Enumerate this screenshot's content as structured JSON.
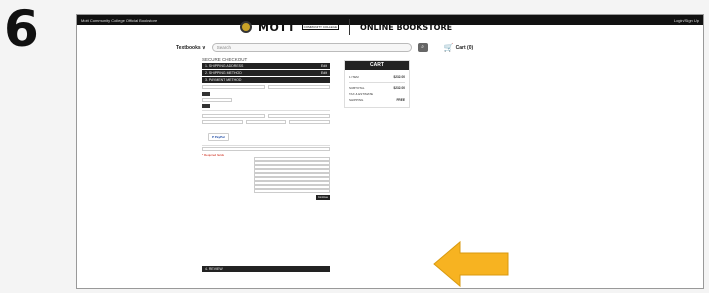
{
  "step_number": "6",
  "topbar": {
    "left": "Mott Community College Official Bookstore",
    "right": "Login/Sign Up"
  },
  "brand": {
    "name": "MOTT",
    "sub": "COMMUNITY COLLEGE",
    "store": "ONLINE BOOKSTORE"
  },
  "nav": {
    "textbooks": "Textbooks ∨",
    "search_placeholder": "Search",
    "cart": "Cart (0)"
  },
  "checkout": {
    "title": "SECURE CHECKOUT",
    "steps": [
      {
        "label": "1. SHIPPING ADDRESS",
        "action": "Edit"
      },
      {
        "label": "2. SHIPPING METHOD",
        "action": "Edit"
      },
      {
        "label": "3. PAYMENT METHOD",
        "action": ""
      }
    ],
    "review": "4. REVIEW",
    "continue": "Continue",
    "required_label": "* Required fields"
  },
  "cart": {
    "title": "CART",
    "lines": [
      {
        "label": "1 ITEM",
        "value": "$232.00"
      },
      {
        "label": "SUBTOTAL",
        "value": "$232.00"
      },
      {
        "label": "TAX & ESTIMATE",
        "value": ""
      },
      {
        "label": "SHIPPING",
        "value": "FREE"
      }
    ]
  },
  "colors": {
    "arrow": "#f7b321",
    "dark": "#222222"
  }
}
